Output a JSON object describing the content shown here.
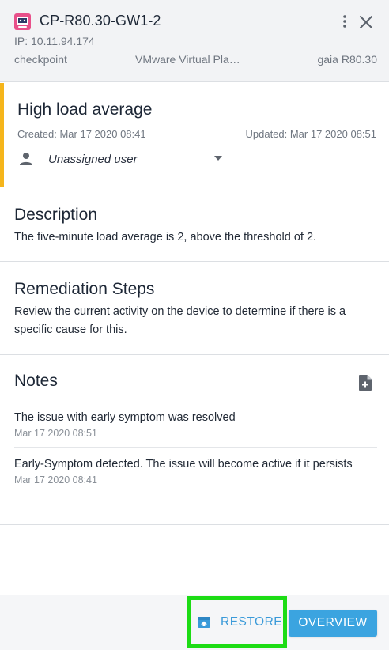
{
  "header": {
    "title": "CP-R80.30-GW1-2",
    "ip": "IP: 10.11.94.174",
    "vendor": "checkpoint",
    "platform": "VMware Virtual Pla…",
    "os": "gaia R80.30",
    "device_icon": "device-avatar-icon",
    "more_icon": "more-vertical-icon",
    "close_icon": "close-icon"
  },
  "issue": {
    "title": "High load average",
    "created": "Created: Mar 17 2020 08:41",
    "updated": "Updated: Mar 17 2020 08:51",
    "assignee": "Unassigned user",
    "severity_color": "#f5b51b"
  },
  "description": {
    "title": "Description",
    "body": "The five-minute load average is 2, above the threshold of 2."
  },
  "remediation": {
    "title": "Remediation Steps",
    "body": "Review the current activity on the device to determine if there is a specific cause for this."
  },
  "notes": {
    "title": "Notes",
    "add_icon": "add-note-icon",
    "items": [
      {
        "text": "The issue with early symptom was resolved",
        "date": "Mar 17 2020 08:51"
      },
      {
        "text": "Early-Symptom detected. The issue will become active if it persists",
        "date": "Mar 17 2020 08:41"
      }
    ]
  },
  "footer": {
    "restore_label": "RESTORE",
    "overview_label": "OVERVIEW",
    "highlight_color": "#1ddc15",
    "accent_color": "#3ba4e0"
  }
}
